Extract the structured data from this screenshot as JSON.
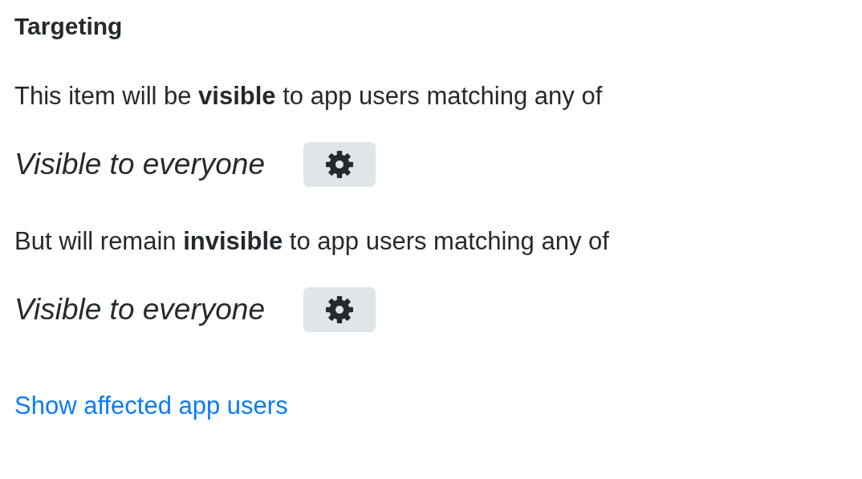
{
  "heading": "Targeting",
  "sections": [
    {
      "sentence": "This item will be **visible** to app users matching any of",
      "rule": "Visible to everyone"
    },
    {
      "sentence": "But will remain **invisible** to app users matching any of",
      "rule": "Visible to everyone"
    }
  ],
  "link": "Show affected app users"
}
